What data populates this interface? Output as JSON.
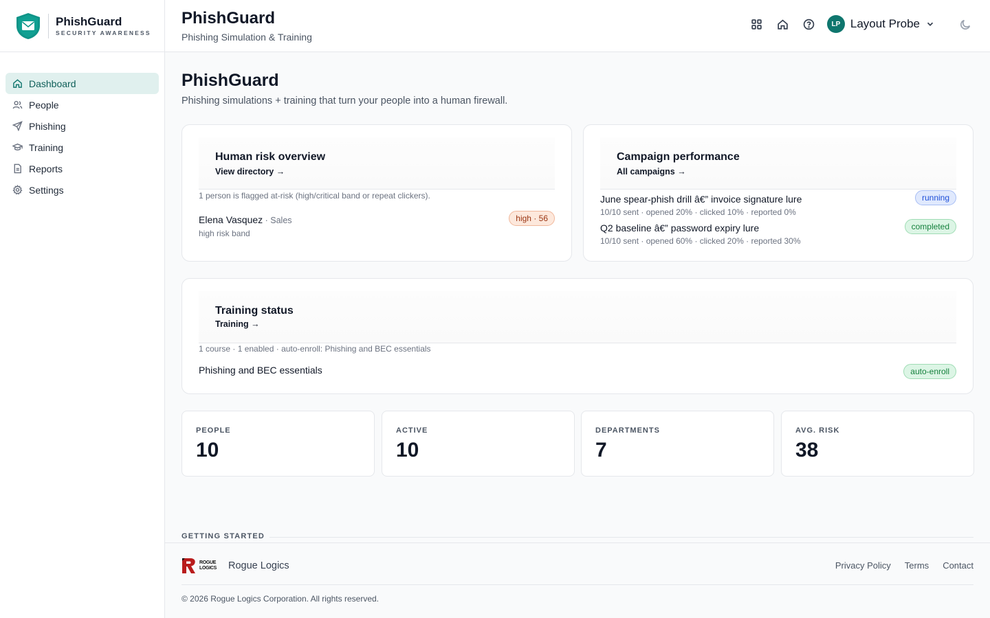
{
  "brand": {
    "name": "PhishGuard",
    "tagline": "SECURITY AWARENESS"
  },
  "sidebar": {
    "items": [
      {
        "label": "Dashboard",
        "icon": "home-icon",
        "active": true
      },
      {
        "label": "People",
        "icon": "users-icon"
      },
      {
        "label": "Phishing",
        "icon": "send-icon"
      },
      {
        "label": "Training",
        "icon": "graduation-cap-icon"
      },
      {
        "label": "Reports",
        "icon": "file-icon"
      },
      {
        "label": "Settings",
        "icon": "gear-icon"
      }
    ]
  },
  "header": {
    "title": "PhishGuard",
    "subtitle": "Phishing Simulation & Training",
    "user": {
      "initials": "LP",
      "name": "Layout Probe"
    },
    "icons": [
      "grid-icon",
      "home-icon",
      "help-icon",
      "chevron-down-icon",
      "moon-icon"
    ]
  },
  "main": {
    "title": "PhishGuard",
    "subtitle": "Phishing simulations + training that turn your people into a human firewall.",
    "risk": {
      "title": "Human risk overview",
      "link": "View directory →",
      "summary": "1 person is flagged at-risk (high/critical band or repeat clickers).",
      "person": {
        "name": "Elena Vasquez",
        "dept": " · Sales",
        "band": "high risk band",
        "badge": "high · 56"
      }
    },
    "campaigns": {
      "title": "Campaign performance",
      "link": "All campaigns →",
      "items": [
        {
          "name": "June spear-phish drill â€” invoice signature lure",
          "stats": "10/10 sent · opened 20% · clicked 10% · reported 0%",
          "status": "running"
        },
        {
          "name": "Q2 baseline â€” password expiry lure",
          "stats": "10/10 sent · opened 60% · clicked 20% · reported 30%",
          "status": "completed"
        }
      ]
    },
    "training": {
      "title": "Training status",
      "link": "Training →",
      "summary": "1 course · 1 enabled · auto-enroll: Phishing and BEC essentials",
      "course": {
        "name": "Phishing and BEC essentials",
        "badge": "auto-enroll"
      }
    },
    "stats": [
      {
        "label": "PEOPLE",
        "value": "10"
      },
      {
        "label": "ACTIVE",
        "value": "10"
      },
      {
        "label": "DEPARTMENTS",
        "value": "7"
      },
      {
        "label": "AVG. RISK",
        "value": "38"
      }
    ],
    "getting_started": "GETTING STARTED"
  },
  "footer": {
    "logo_text": "ROGUE LOGICS",
    "company": "Rogue Logics",
    "links": [
      "Privacy Policy",
      "Terms",
      "Contact"
    ],
    "copyright": "© 2026 Rogue Logics Corporation. All rights reserved."
  },
  "colors": {
    "accent": "#0f766e",
    "active_bg": "#e0f0ee",
    "logo_red": "#b91c1c"
  }
}
